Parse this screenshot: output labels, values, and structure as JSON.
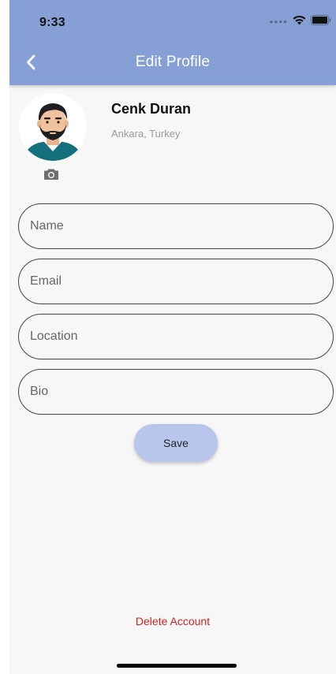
{
  "status_bar": {
    "time": "9:33",
    "signal_icon": "cellular-dots",
    "wifi_icon": "wifi-icon",
    "battery_icon": "battery-icon"
  },
  "header": {
    "title": "Edit Profile",
    "back_icon": "chevron-left-icon",
    "background_color": "#86a0d5"
  },
  "profile": {
    "name": "Cenk Duran",
    "location": "Ankara, Turkey",
    "avatar_icon": "avatar-man-beard",
    "camera_icon": "camera-icon"
  },
  "form": {
    "name": {
      "placeholder": "Name",
      "value": ""
    },
    "email": {
      "placeholder": "Email",
      "value": ""
    },
    "location": {
      "placeholder": "Location",
      "value": ""
    },
    "bio": {
      "placeholder": "Bio",
      "value": ""
    }
  },
  "actions": {
    "save_label": "Save",
    "save_color": "#b9c6ec",
    "delete_label": "Delete Account",
    "delete_color": "#d32424"
  }
}
